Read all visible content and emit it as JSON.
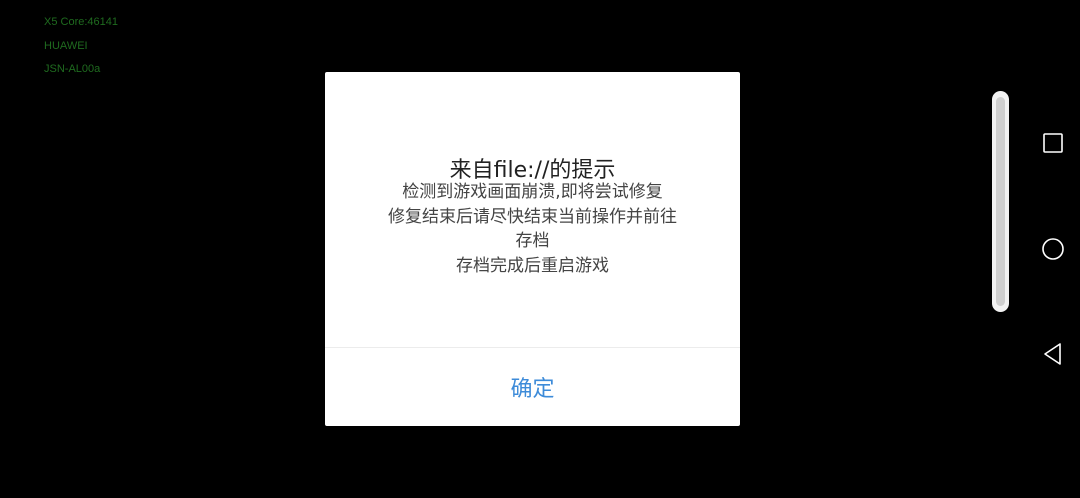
{
  "debug": {
    "line1": "X5 Core:46141",
    "line2": "HUAWEI",
    "line3": "JSN-AL00a"
  },
  "dialog": {
    "title": "来自file://的提示",
    "message_lines": [
      "检测到游戏画面崩溃,即将尝试修复",
      "修复结束后请尽快结束当前操作并前往",
      "存档",
      "存档完成后重启游戏"
    ],
    "confirm_label": "确定"
  },
  "navbar": {
    "icons": [
      "square-recent-apps-icon",
      "circle-home-icon",
      "triangle-back-icon"
    ]
  },
  "colors": {
    "background": "#000000",
    "dialog_bg": "#ffffff",
    "accent": "#3d8bd9",
    "debug_text": "#1f6b1f"
  }
}
